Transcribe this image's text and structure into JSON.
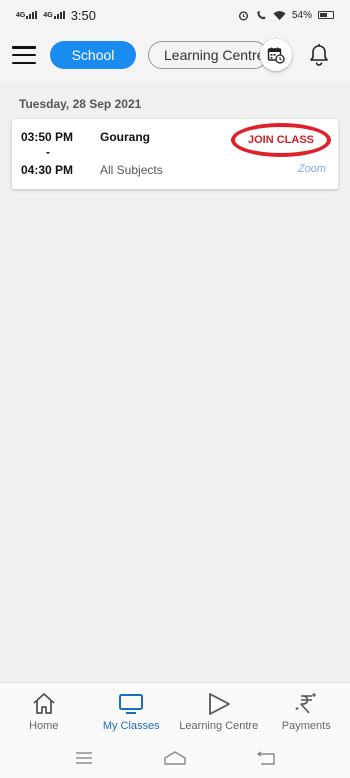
{
  "status": {
    "net1": "4G",
    "net2": "4G",
    "time": "3:50",
    "battery": "54%"
  },
  "header": {
    "tabs": [
      {
        "label": "School",
        "active": true
      },
      {
        "label": "Learning Centre",
        "active": false
      }
    ],
    "icons": [
      "menu-icon",
      "calendar-clock-icon",
      "bell-icon"
    ]
  },
  "schedule": {
    "date": "Tuesday, 28 Sep 2021",
    "classes": [
      {
        "start": "03:50 PM",
        "separator": "-",
        "end": "04:30 PM",
        "teacher": "Gourang",
        "subject": "All Subjects",
        "action": "JOIN CLASS",
        "platform": "Zoom"
      }
    ]
  },
  "bottom_nav": {
    "items": [
      {
        "label": "Home",
        "icon": "home-icon",
        "active": false
      },
      {
        "label": "My Classes",
        "icon": "monitor-icon",
        "active": true
      },
      {
        "label": "Learning Centre",
        "icon": "play-icon",
        "active": false
      },
      {
        "label": "Payments",
        "icon": "rupee-icon",
        "active": false
      }
    ]
  },
  "colors": {
    "accent": "#1a8cf0",
    "active_nav": "#1a6fc0",
    "join": "#d0202a"
  }
}
